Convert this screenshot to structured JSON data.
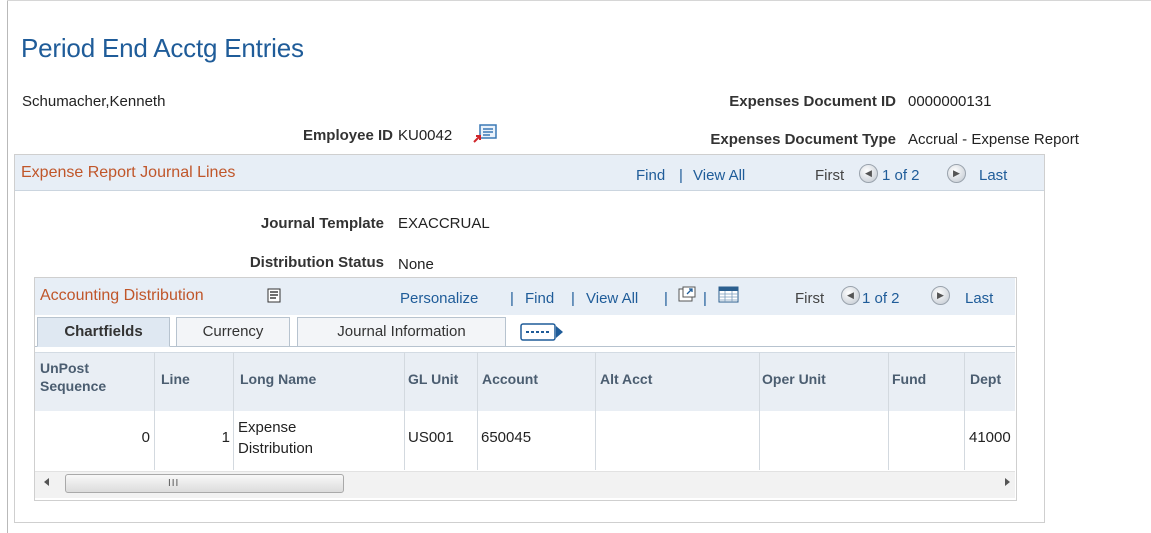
{
  "page": {
    "title": "Period End Acctg Entries"
  },
  "employee": {
    "name": "Schumacher,Kenneth",
    "id_label": "Employee ID",
    "id_value": "KU0042"
  },
  "document": {
    "id_label": "Expenses Document ID",
    "id_value": "0000000131",
    "type_label": "Expenses Document Type",
    "type_value": "Accrual - Expense Report"
  },
  "journal_lines": {
    "title": "Expense Report Journal Lines",
    "find": "Find",
    "sep": "|",
    "view_all": "View All",
    "first": "First",
    "pager": "1 of 2",
    "last": "Last",
    "template_label": "Journal Template",
    "template_value": "EXACCRUAL",
    "status_label": "Distribution Status",
    "status_value": "None"
  },
  "distribution": {
    "title": "Accounting Distribution",
    "personalize": "Personalize",
    "find": "Find",
    "view_all": "View All",
    "sep": "|",
    "first": "First",
    "pager": "1 of 2",
    "last": "Last",
    "tabs": [
      "Chartfields",
      "Currency",
      "Journal Information"
    ],
    "columns": [
      "UnPost Sequence",
      "Line",
      "Long Name",
      "GL Unit",
      "Account",
      "Alt Acct",
      "Oper Unit",
      "Fund",
      "Dept"
    ],
    "rows": [
      {
        "unpost_seq": "0",
        "line": "1",
        "long_name": "Expense Distribution",
        "gl_unit": "US001",
        "account": "650045",
        "alt_acct": "",
        "oper_unit": "",
        "fund": "",
        "dept": "41000"
      }
    ],
    "scroll_grip": "III"
  },
  "icons": {
    "lookup": "employee-lookup-icon",
    "personalize": "personalize-grid-icon",
    "zoom": "zoom-grid-icon",
    "download": "download-grid-icon",
    "prev": "prev-circle-icon",
    "next": "next-circle-icon",
    "more_tabs": "show-all-columns-icon"
  },
  "colors": {
    "title": "#1f5c99",
    "section_title": "#c0562a",
    "link": "#1f5c99",
    "header_bg": "#e7eef6"
  }
}
